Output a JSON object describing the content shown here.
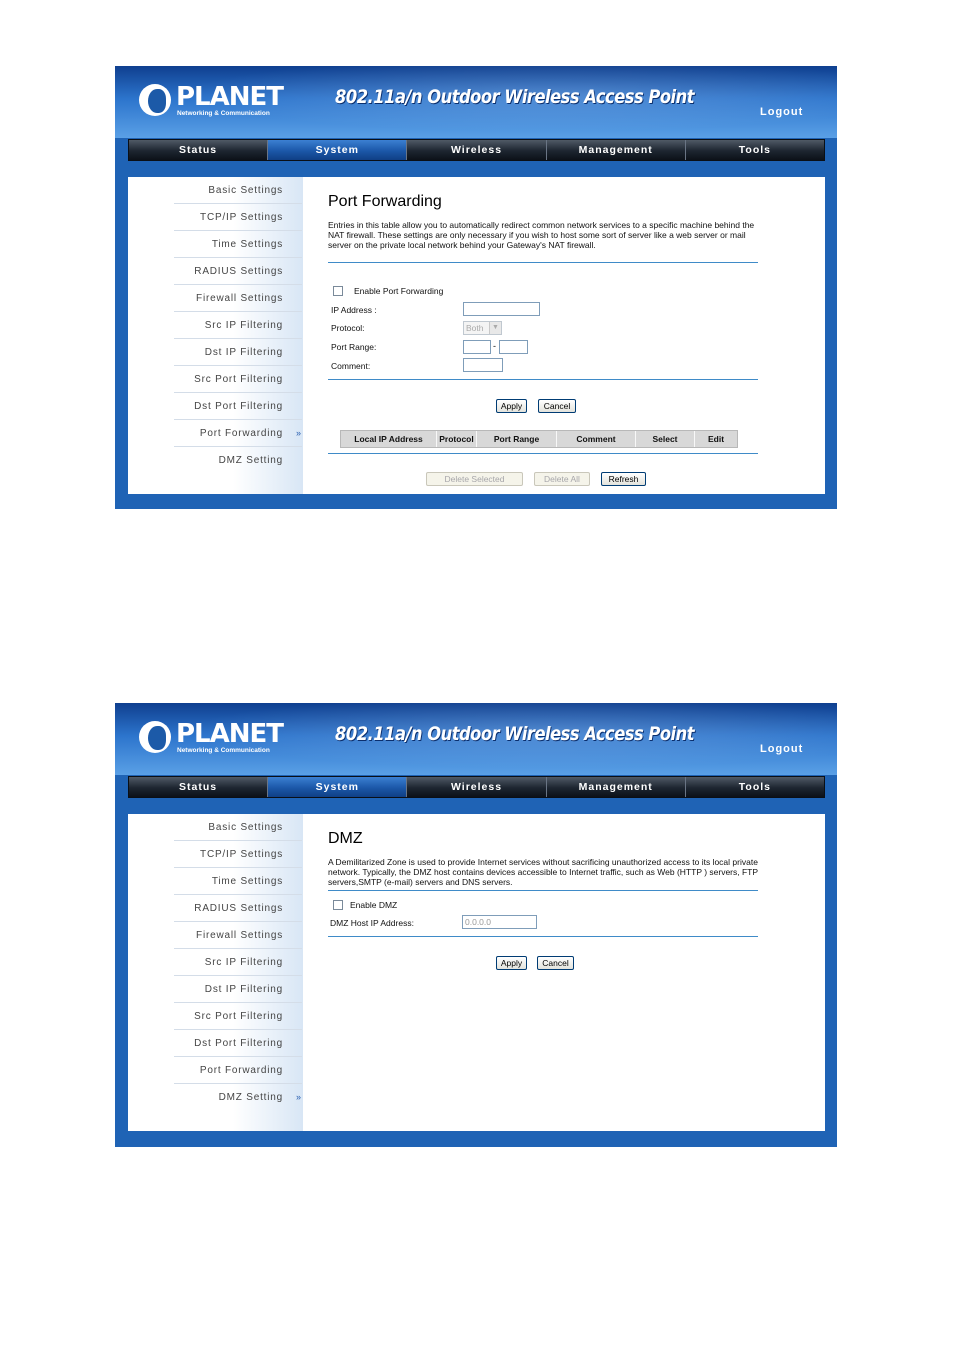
{
  "brand": {
    "logo_text": "PLANET",
    "logo_sub": "Networking & Communication",
    "product_title": "802.11a/n Outdoor Wireless Access Point",
    "logout": "Logout"
  },
  "nav": [
    "Status",
    "System",
    "Wireless",
    "Management",
    "Tools"
  ],
  "nav_active": "System",
  "sidebar": [
    "Basic Settings",
    "TCP/IP Settings",
    "Time Settings",
    "RADIUS Settings",
    "Firewall Settings",
    "Src IP Filtering",
    "Dst IP Filtering",
    "Src Port Filtering",
    "Dst Port Filtering",
    "Port Forwarding",
    "DMZ Setting"
  ],
  "chevron": "»",
  "port_forwarding": {
    "title": "Port Forwarding",
    "description": "Entries in this table allow you to automatically redirect common network services to a specific machine behind the NAT firewall. These settings are only necessary if you wish to host some sort of server like a web server or mail server on the private local network behind your Gateway's NAT firewall.",
    "enable_label": "Enable Port Forwarding",
    "ip_label": "IP Address :",
    "protocol_label": "Protocol:",
    "protocol_value": "Both",
    "port_range_label": "Port Range:",
    "port_range_sep": "-",
    "comment_label": "Comment:",
    "apply": "Apply",
    "cancel": "Cancel",
    "table_headers": [
      "Local IP Address",
      "Protocol",
      "Port Range",
      "Comment",
      "Select",
      "Edit"
    ],
    "delete_selected": "Delete Selected",
    "delete_all": "Delete All",
    "refresh": "Refresh"
  },
  "dmz": {
    "title": "DMZ",
    "description": "A Demilitarized Zone is used to provide Internet services without sacrificing unauthorized access to its local private network. Typically, the DMZ host contains devices accessible to Internet traffic, such as Web (HTTP ) servers, FTP servers,SMTP (e-mail) servers and DNS servers.",
    "enable_label": "Enable DMZ",
    "host_ip_label": "DMZ Host IP Address:",
    "host_ip_value": "0.0.0.0",
    "apply": "Apply",
    "cancel": "Cancel"
  },
  "colors": {
    "frame_blue": "#1f63b5",
    "nav_dark": "#1d2530",
    "nav_active": "#1b57a8",
    "rule": "#3f8bc8"
  }
}
